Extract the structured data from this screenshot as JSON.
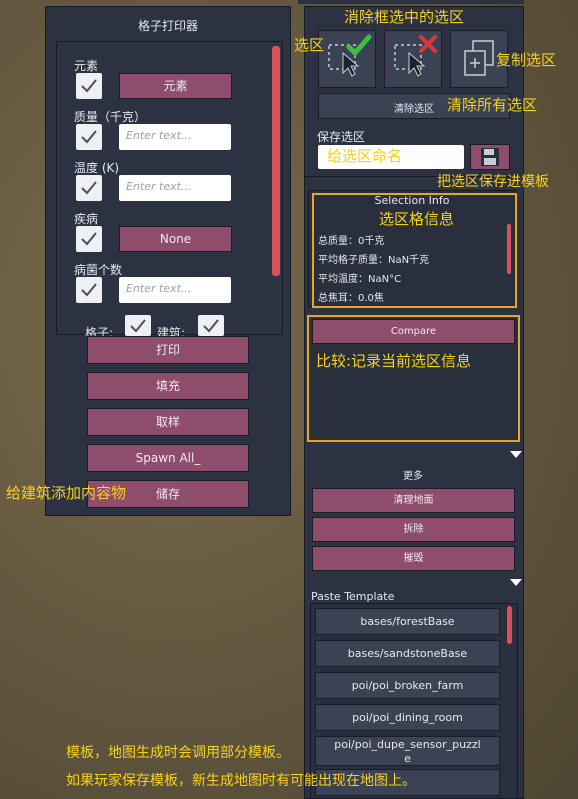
{
  "colors": {
    "panel": "#2c3242",
    "button": "#8e4d6c",
    "annotation": "#f7d218",
    "highlight": "#e6a526",
    "scroll": "#d9515a"
  },
  "left_panel": {
    "title": "格子打印器",
    "element_label": "元素",
    "element_button": "元素",
    "mass_label": "质量（千克）",
    "mass_placeholder": "Enter text...",
    "temp_label": "温度 (K)",
    "temp_placeholder": "Enter text...",
    "disease_label": "疾病",
    "disease_button": "None",
    "germ_label": "病菌个数",
    "germ_placeholder": "Enter text...",
    "cells_label": "格子:",
    "buildings_label": "建筑:",
    "actions": [
      "打印",
      "填充",
      "取样",
      "Spawn All_",
      "储存"
    ]
  },
  "right_panel": {
    "clear_all_button": "清除选区",
    "save_label": "保存选区",
    "selection_info_title": "Selection Info",
    "info_lines": [
      "总质量：0千克",
      "平均格子质量：NaN千克",
      "平均温度：NaN°C",
      "总焦耳：0.0焦"
    ],
    "compare_button": "Compare",
    "more_label": "更多",
    "more_buttons": [
      "清理地面",
      "拆除",
      "摧毁"
    ],
    "paste_template_label": "Paste Template",
    "templates": [
      "bases/forestBase",
      "bases/sandstoneBase",
      "poi/poi_broken_farm",
      "poi/poi_dining_room",
      "poi/poi_dupe_sensor_puzzl\ne"
    ]
  },
  "annotations": {
    "deselect": "消除框选中的选区",
    "select": "选区",
    "copy": "复制选区",
    "clear_all": "清除所有选区",
    "name_placeholder": "给选区命名",
    "save_template": "把选区保存进模板",
    "info": "选区格信息",
    "compare": "比较:记录当前选区信息",
    "add_contents": "给建筑添加内容物",
    "template_note_1": "模板，地图生成时会调用部分模板。",
    "template_note_2": "如果玩家保存模板，新生成地图时有可能出现在地图上。"
  }
}
